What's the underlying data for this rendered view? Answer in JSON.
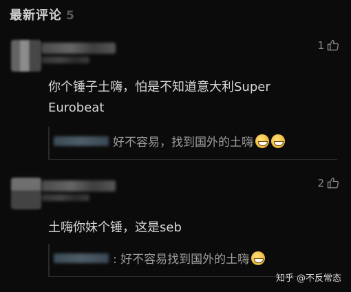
{
  "header": {
    "title": "最新评论",
    "count": "5"
  },
  "comments": [
    {
      "likes": "1",
      "text": "你个锤子土嗨，怕是不知道意大利Super Eurobeat",
      "reply": {
        "text": "好不容易，找到国外的土嗨",
        "emoji_count": 2
      }
    },
    {
      "likes": "2",
      "text": "土嗨你妹个锤，这是seb",
      "reply": {
        "text": ": 好不容易找到国外的土嗨",
        "emoji_count": 1
      }
    }
  ],
  "footer": {
    "watermark": "知乎 @不反常态"
  },
  "colors": {
    "background": "#0b0b0b",
    "text": "#d8d8d8",
    "muted": "#9d9d9d"
  },
  "icons": {
    "like": "thumbs-up-icon",
    "emoji": "grinning-face-icon"
  }
}
